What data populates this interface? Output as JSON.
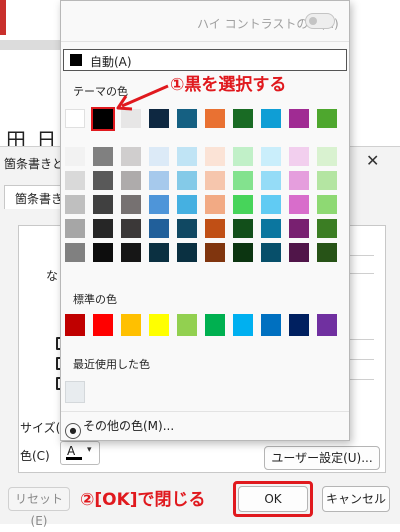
{
  "background_dialog": {
    "title": "箇条書きと",
    "tab_label": "箇条書き",
    "stub_text": "な",
    "size_label": "サイズ(S",
    "color_label": "色(C)",
    "color_button_glyph": "A",
    "user_settings_button": "ユーザー設定(U)...",
    "reset_button": "リセット(E)",
    "ok_button": "OK",
    "cancel_button": "キャンセル",
    "strip_symbols": "田 日"
  },
  "popup": {
    "high_contrast_label": "ハイ コントラストのみ(H)",
    "auto_label": "自動(A)",
    "theme_colors_label": "テーマの色",
    "standard_colors_label": "標準の色",
    "recent_colors_label": "最近使用した色",
    "more_colors_label": "その他の色(M)...",
    "theme_colors": [
      "#ffffff",
      "#000000",
      "#e7e6e6",
      "#0e2841",
      "#156082",
      "#e97132",
      "#196b24",
      "#0f9ed5",
      "#a02b93",
      "#4ea72e"
    ],
    "theme_shades": [
      [
        "#f2f2f2",
        "#d9d9d9",
        "#bfbfbf",
        "#a6a6a6",
        "#808080"
      ],
      [
        "#808080",
        "#595959",
        "#404040",
        "#262626",
        "#0d0d0d"
      ],
      [
        "#d0cece",
        "#aeabab",
        "#767171",
        "#3b3838",
        "#161616"
      ],
      [
        "#dceaf7",
        "#a6c9ec",
        "#4e95d9",
        "#215f9a",
        "#0b3041"
      ],
      [
        "#c0e4f5",
        "#84cae8",
        "#45b0e1",
        "#104862",
        "#0a3041"
      ],
      [
        "#fbe3d6",
        "#f6c6ad",
        "#f2aa84",
        "#c04f15",
        "#80350e"
      ],
      [
        "#c1f0c8",
        "#83e28e",
        "#47d45a",
        "#124f1a",
        "#0c3511"
      ],
      [
        "#caeefb",
        "#95dcf7",
        "#61cbf3",
        "#0b769f",
        "#074f6a"
      ],
      [
        "#f2cfee",
        "#e59edd",
        "#d86dcb",
        "#782070",
        "#501549"
      ],
      [
        "#d9f2d0",
        "#b4e5a2",
        "#8ed973",
        "#3b7d23",
        "#275317"
      ]
    ],
    "standard_colors": [
      "#c00000",
      "#ff0000",
      "#ffc000",
      "#ffff00",
      "#92d050",
      "#00b050",
      "#00b0f0",
      "#0070c0",
      "#002060",
      "#7030a0"
    ],
    "recent_colors": [
      "#e8ecef"
    ]
  },
  "annotations": {
    "step1": "①黒を選択する",
    "step2": "②[OK]で閉じる",
    "highlight_color": "#e0191e"
  }
}
